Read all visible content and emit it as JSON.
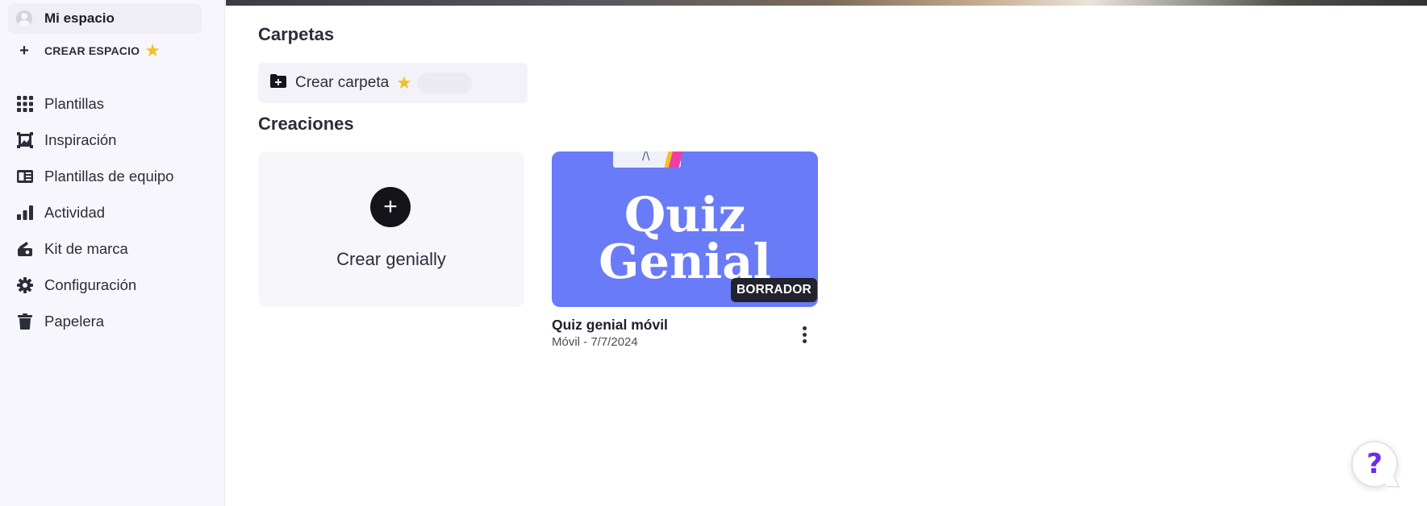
{
  "sidebar": {
    "space": {
      "label": "Mi espacio",
      "icon": "user-avatar-icon"
    },
    "create_space": {
      "label": "CREAR ESPACIO",
      "icon": "plus-icon",
      "badge_icon": "star-icon"
    },
    "items": [
      {
        "label": "Plantillas",
        "icon": "grid-icon"
      },
      {
        "label": "Inspiración",
        "icon": "frame-image-icon"
      },
      {
        "label": "Plantillas de equipo",
        "icon": "team-templates-icon"
      },
      {
        "label": "Actividad",
        "icon": "bar-chart-icon"
      },
      {
        "label": "Kit de marca",
        "icon": "brand-kit-icon"
      },
      {
        "label": "Configuración",
        "icon": "gear-icon"
      },
      {
        "label": "Papelera",
        "icon": "trash-icon"
      }
    ]
  },
  "main": {
    "folders_title": "Carpetas",
    "create_folder": {
      "label": "Crear carpeta",
      "icon": "folder-plus-icon",
      "badge_icon": "star-icon"
    },
    "creations_title": "Creaciones",
    "create_card": {
      "label": "Crear genially",
      "icon": "plus-icon"
    },
    "creations": [
      {
        "thumbnail_text": "Quiz Genial",
        "thumbnail_line1": "Quiz",
        "thumbnail_line2": "Genial",
        "badge": "BORRADOR",
        "name": "Quiz genial móvil",
        "meta": "Móvil - 7/7/2024"
      }
    ]
  },
  "help": {
    "label": "?",
    "icon": "help-question-icon"
  },
  "colors": {
    "sidebar_bg": "#f7f6fc",
    "accent_star": "#f2c025",
    "thumb_bg": "#6a7bf7",
    "help_purple": "#6a2cf0",
    "badge_bg": "#22232e"
  }
}
